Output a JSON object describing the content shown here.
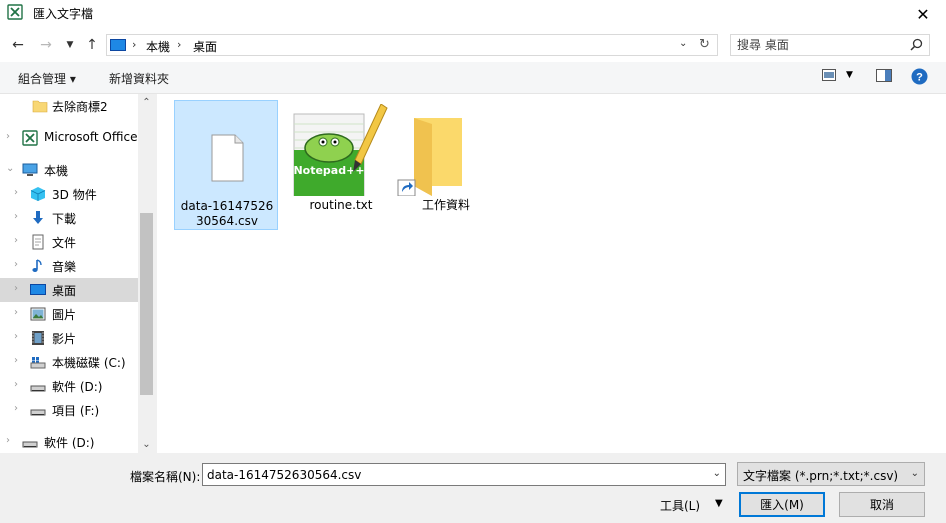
{
  "window": {
    "title": "匯入文字檔"
  },
  "address": {
    "crumbs": [
      "本機",
      "桌面"
    ]
  },
  "search": {
    "placeholder": "搜尋 桌面"
  },
  "toolbar": {
    "organize": "組合管理 ▾",
    "new_folder": "新增資料夾"
  },
  "sidebar": {
    "items": [
      {
        "label": "去除商標2",
        "icon": "folder-icon"
      },
      {
        "label": "Microsoft Office",
        "icon": "excel-icon"
      },
      {
        "label": "本機",
        "icon": "computer-icon"
      },
      {
        "label": "3D 物件",
        "icon": "3d-objects-icon"
      },
      {
        "label": "下載",
        "icon": "download-icon"
      },
      {
        "label": "文件",
        "icon": "documents-icon"
      },
      {
        "label": "音樂",
        "icon": "music-icon"
      },
      {
        "label": "桌面",
        "icon": "desktop-icon"
      },
      {
        "label": "圖片",
        "icon": "pictures-icon"
      },
      {
        "label": "影片",
        "icon": "videos-icon"
      },
      {
        "label": "本機磁碟 (C:)",
        "icon": "drive-c-icon"
      },
      {
        "label": "軟件 (D:)",
        "icon": "drive-icon"
      },
      {
        "label": "項目 (F:)",
        "icon": "drive-icon"
      },
      {
        "label": "軟件 (D:)",
        "icon": "drive-icon"
      }
    ]
  },
  "files": [
    {
      "name": "data-1614752630564.csv",
      "icon": "blank-file-icon"
    },
    {
      "name": "routine.txt",
      "icon": "notepad-plus-plus-icon"
    },
    {
      "name": "工作資料",
      "icon": "folder-shortcut-icon"
    }
  ],
  "footer": {
    "filename_label": "檔案名稱(N):",
    "filename_value": "data-1614752630564.csv",
    "filetype": "文字檔案 (*.prn;*.txt;*.csv)",
    "tools": "工具(L)",
    "import": "匯入(M)",
    "cancel": "取消"
  },
  "colors": {
    "selection": "#cce8ff",
    "accent": "#0078d7"
  }
}
